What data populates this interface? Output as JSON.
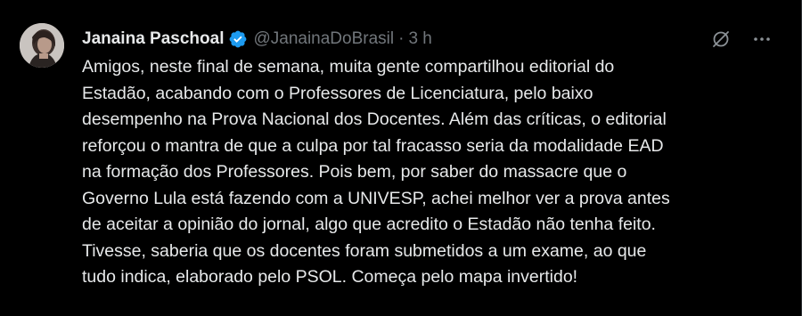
{
  "tweet": {
    "author_name": "Janaina Paschoal",
    "handle": "@JanainaDoBrasil",
    "separator": "·",
    "timestamp": "3 h",
    "verified_icon": "verified-badge-icon",
    "text": "Amigos, neste final de semana, muita gente compartilhou editorial do\nEstadão, acabando com o Professores de Licenciatura, pelo baixo\ndesempenho na Prova Nacional dos Docentes. Além das críticas, o editorial\nreforçou o mantra de que a culpa por tal fracasso seria da modalidade EAD\nna formação dos Professores. Pois bem, por saber do massacre que o\nGoverno Lula está fazendo com a UNIVESP, achei melhor ver a prova antes\nde aceitar a opinião do jornal, algo que acredito o Estadão não tenha feito.\nTivesse, saberia que os docentes foram submetidos a um exame, ao que\ntudo indica, elaborado pelo PSOL. Começa pelo mapa invertido!",
    "actions": {
      "grok_icon": "grok-slash-icon",
      "more_icon": "more-options-icon"
    }
  },
  "colors": {
    "background": "#000000",
    "text_primary": "#e7e9ea",
    "text_secondary": "#71767b",
    "verified_blue": "#1d9bf0",
    "border": "#2f3336"
  }
}
